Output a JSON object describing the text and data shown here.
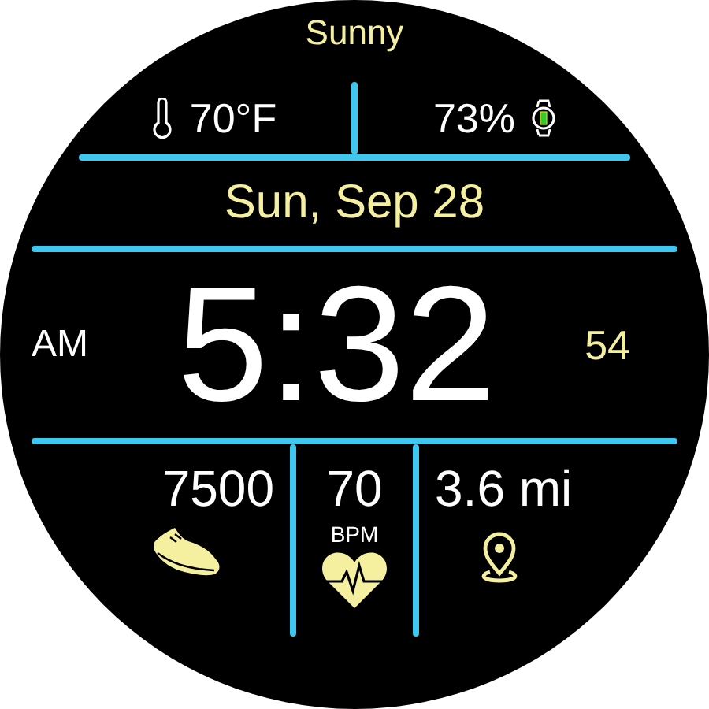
{
  "weather": "Sunny",
  "temperature": "70°F",
  "battery": "73%",
  "date": "Sun, Sep 28",
  "time": {
    "ampm": "AM",
    "clock": "5:32",
    "seconds": "54"
  },
  "stats": [
    {
      "kind": "steps",
      "value": "7500"
    },
    {
      "kind": "heart",
      "value": "70",
      "unit": "BPM"
    },
    {
      "kind": "distance",
      "value": "3.6 mi"
    }
  ]
}
